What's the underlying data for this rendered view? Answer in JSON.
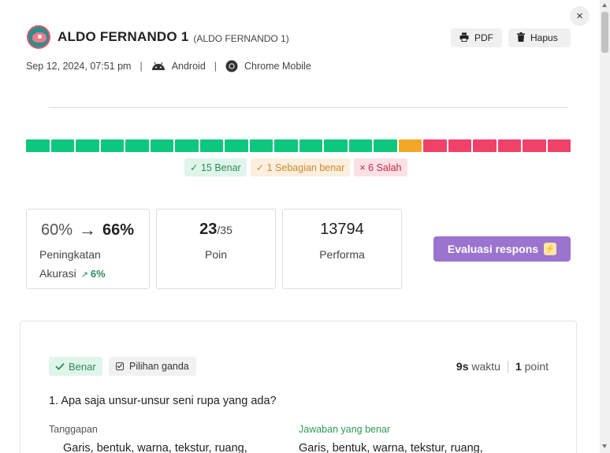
{
  "header": {
    "name": "ALDO FERNANDO 1",
    "sub": "(ALDO FERNANDO 1)",
    "pdf_label": "PDF",
    "delete_label": "Hapus",
    "close_glyph": "×"
  },
  "meta": {
    "datetime": "Sep 12, 2024, 07:51 pm",
    "os": "Android",
    "browser": "Chrome Mobile",
    "separator": "|"
  },
  "progress": {
    "correct_color": "#0ec77f",
    "partial_color": "#f2a826",
    "wrong_color": "#f0416a",
    "segments": [
      "correct",
      "correct",
      "correct",
      "correct",
      "correct",
      "correct",
      "correct",
      "correct",
      "correct",
      "correct",
      "correct",
      "correct",
      "correct",
      "correct",
      "correct",
      "partial",
      "wrong",
      "wrong",
      "wrong",
      "wrong",
      "wrong",
      "wrong"
    ]
  },
  "summary": {
    "correct": "✓ 15 Benar",
    "partial": "✓ 1 Sebagian benar",
    "wrong": "× 6 Salah"
  },
  "stats": {
    "accuracy_from": "60%",
    "accuracy_to": "66%",
    "accuracy_label1": "Peningkatan",
    "accuracy_label2": "Akurasi",
    "accuracy_delta": "6%",
    "points_value": "23",
    "points_total": "/35",
    "points_label": "Poin",
    "performance_value": "13794",
    "performance_label": "Performa"
  },
  "evaluate_label": "Evaluasi respons",
  "question": {
    "status": "Benar",
    "type": "Pilihan ganda",
    "time_value": "9s",
    "time_unit": "waktu",
    "points_value": "1",
    "points_unit": "point",
    "text": "1. Apa saja unsur-unsur seni rupa yang ada?",
    "response_label": "Tanggapan",
    "correct_label": "Jawaban yang benar",
    "response_value": "Garis, bentuk, warna, tekstur, ruang,",
    "correct_value": "Garis, bentuk, warna, tekstur, ruang,"
  },
  "icons": {
    "close": "close-icon",
    "pdf": "printer-icon",
    "delete": "trash-icon",
    "os": "android-icon",
    "browser": "chrome-icon",
    "arrow": "arrow-right-icon",
    "check": "check-icon",
    "checkbox": "checkbox-icon",
    "spark": "lightning-icon"
  }
}
